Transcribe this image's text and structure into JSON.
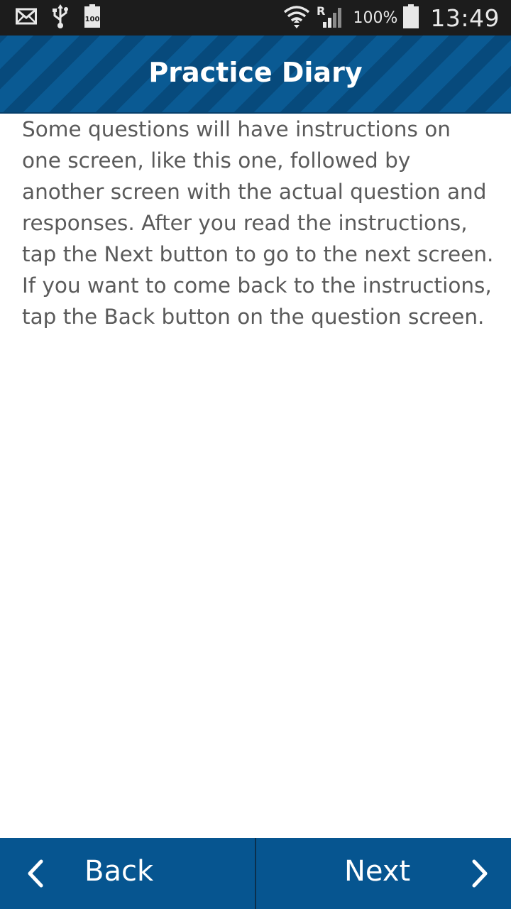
{
  "status_bar": {
    "icons_left": [
      "mail-icon",
      "usb-icon",
      "battery-100-icon"
    ],
    "battery_badge": "100",
    "signal_label": "R",
    "battery_percent": "100%",
    "time": "13:49"
  },
  "header": {
    "title": "Practice Diary"
  },
  "main": {
    "instructions": "Some questions will have instructions on one screen, like this one, followed by another screen with the actual question and responses. After you read the instructions, tap the Next button to go to the next screen. If you want to come back to the instructions, tap the Back button on the question screen."
  },
  "footer": {
    "back_label": "Back",
    "next_label": "Next"
  },
  "colors": {
    "header_stripe_light": "#0a5a93",
    "header_stripe_dark": "#074a7c",
    "footer_bg": "#065590",
    "body_text": "#5a5a5a"
  }
}
